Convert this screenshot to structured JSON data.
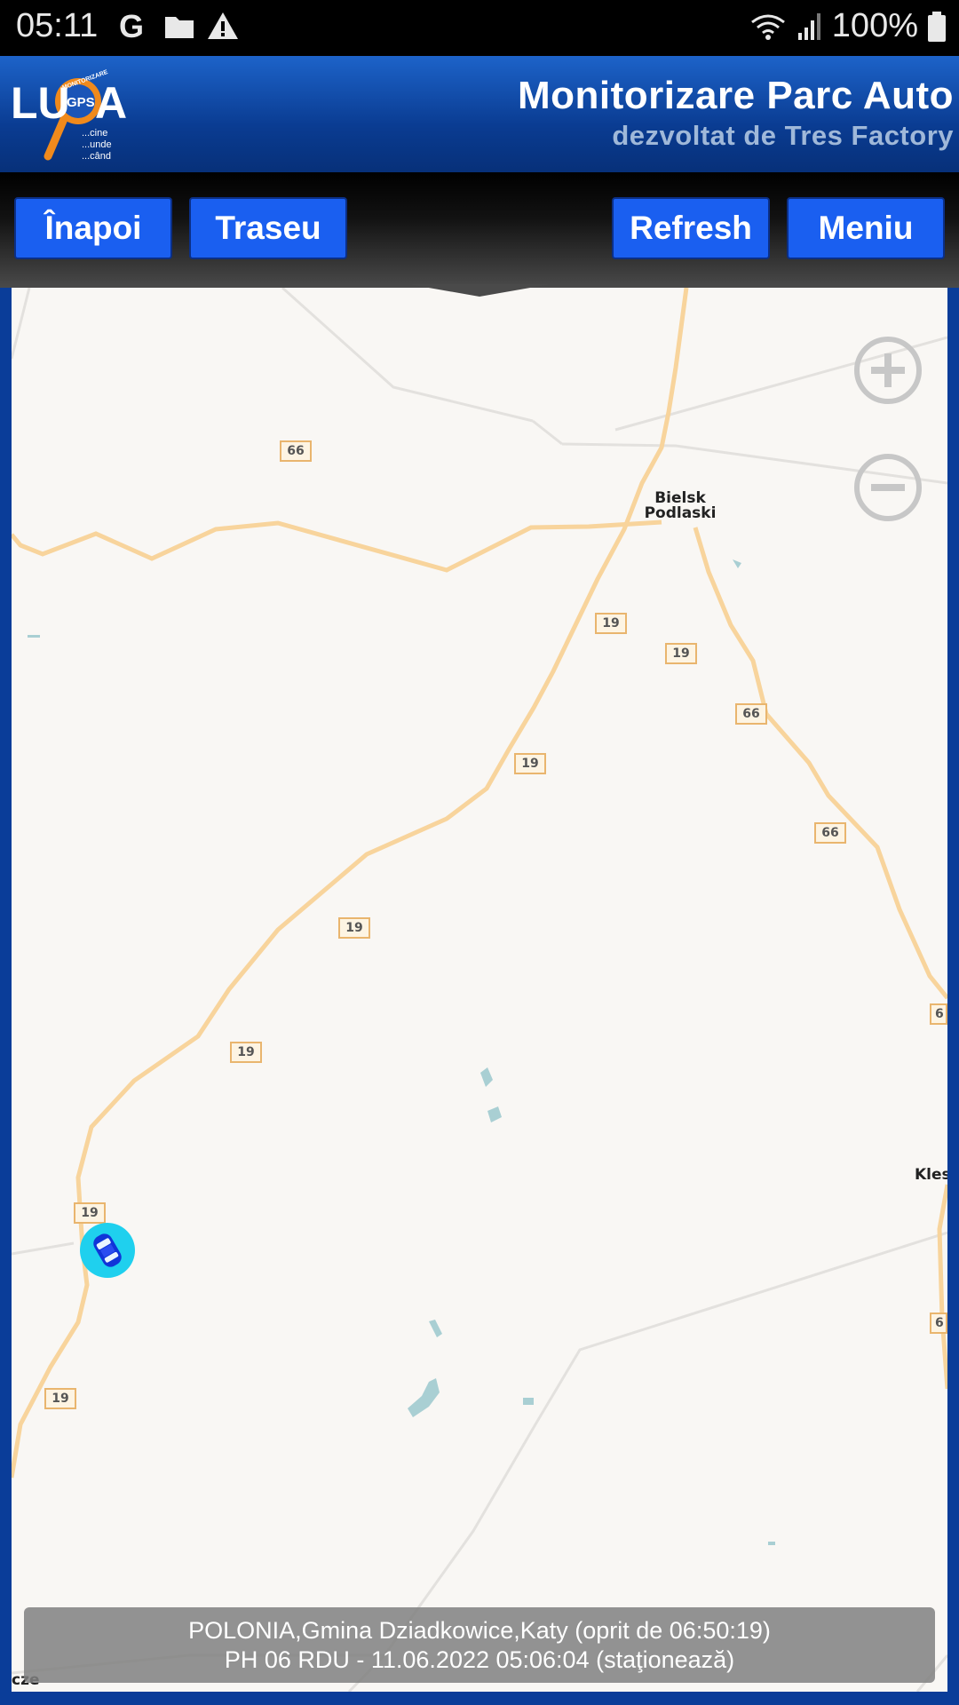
{
  "status_bar": {
    "time": "05:11",
    "battery": "100%",
    "icons": [
      "google-icon",
      "folder-icon",
      "warning-icon",
      "wifi-icon",
      "signal-icon",
      "battery-icon"
    ]
  },
  "header": {
    "title": "Monitorizare Parc Auto",
    "subtitle": "dezvoltat de Tres Factory",
    "logo": {
      "wordmark": "LUPA",
      "badge": "GPS",
      "ring": "MONITORIZARE",
      "taglines": [
        "...cine",
        "...unde",
        "...când"
      ]
    }
  },
  "toolbar": {
    "back_label": "Înapoi",
    "route_label": "Traseu",
    "refresh_label": "Refresh",
    "menu_label": "Meniu"
  },
  "map": {
    "cities": {
      "bielsk_line1": "Bielsk",
      "bielsk_line2": "Podlaski",
      "kles": "Kles",
      "cze": "cze"
    },
    "road_19": "19",
    "road_66": "66",
    "road_6_partial": "6",
    "zoom_in_icon": "plus-circle-icon",
    "zoom_out_icon": "minus-circle-icon",
    "vehicle_icon": "car-icon"
  },
  "info": {
    "line1": "POLONIA,Gmina Dziadkowice,Katy (oprit de 06:50:19)",
    "line2": "PH 06 RDU - 11.06.2022 05:06:04 (staţionează)"
  },
  "colors": {
    "header_blue": "#0a3c92",
    "button_blue": "#1a5ff0",
    "road": "#f8d49c",
    "map_bg": "#f9f7f4",
    "vehicle_halo": "#1fd0ee"
  }
}
